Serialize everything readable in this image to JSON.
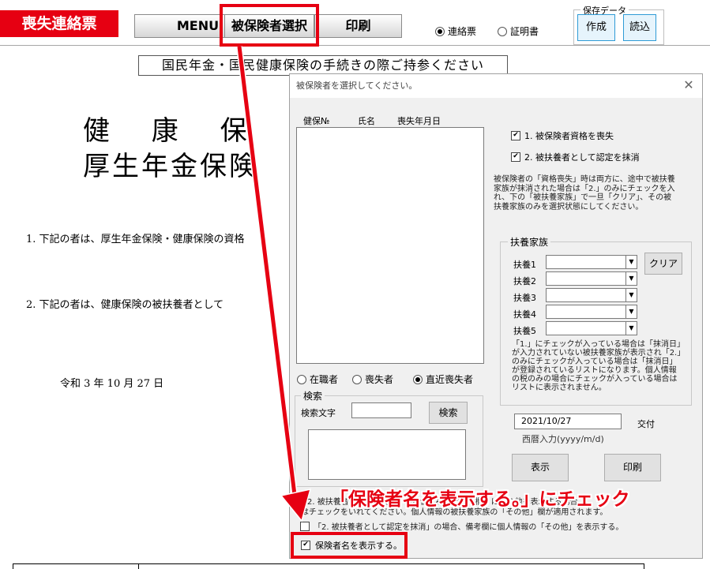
{
  "toolbar": {
    "title": "喪失連絡票",
    "menu": "MENU",
    "select_insured": "被保険者選択",
    "print": "印刷",
    "radio_contact": "連絡票",
    "radio_certificate": "証明書",
    "save_data_legend": "保存データ",
    "create": "作成",
    "load": "読込"
  },
  "document": {
    "notice": "国民年金・国民健康保険の手続きの際ご持参ください",
    "title_line1": "健 康 保 険",
    "title_line2": "厚生年金保険",
    "item1": "1. 下記の者は、厚生年金保険・健康保険の資格",
    "item2": "2. 下記の者は、健康保険の被扶養者として",
    "date": "令和 3 年 10 月 27 日"
  },
  "dialog": {
    "title": "被保険者を選択してください。",
    "columns": [
      "健保№",
      "氏名",
      "喪失年月日"
    ],
    "check1": "1. 被保険者資格を喪失",
    "check2": "2. 被扶養者として認定を抹消",
    "explanation": "被保険者の「資格喪失」時は両方に、途中で被扶養家族が抹消された場合は「2.」のみにチェックを入れ、下の「被扶養家族」で一旦「クリア」、その被扶養家族のみを選択状態にしてください。",
    "dependents_legend": "扶養家族",
    "dependents": [
      "扶養1",
      "扶養2",
      "扶養3",
      "扶養4",
      "扶養5"
    ],
    "clear": "クリア",
    "dependents_note": "「1.」にチェックが入っている場合は「抹消日」が入力されていない被扶養家族が表示され「2.」のみにチェックが入っている場合は「抹消日」が登録されているリストになります。個人情報の税のみの場合にチェックが入っている場合はリストに表示されません。",
    "status_employed": "在職者",
    "status_lost": "喪失者",
    "status_recent": "直近喪失者",
    "search_legend": "検索",
    "search_label": "検索文字",
    "search_value": "",
    "search_button": "検索",
    "date_value": "2021/10/27",
    "issue_label": "交付",
    "date_hint": "西暦入力(yyyy/m/d)",
    "show_button": "表示",
    "print_button": "印刷",
    "note_line1": "2. 被扶養者の「資格喪失」の場合「被保険者考欄」にその他を表示する場合",
    "note_line2": "はチェックをいれてください。個人情報の被扶養家族の「その他」欄が適用されます。",
    "note_line3": "「2. 被扶養者として認定を抹消」の場合、備考欄に個人情報の「その他」を表示する。",
    "show_name_check": "保険者名を表示する。"
  },
  "annotation": "「保険者名を表示する。」にチェック",
  "colors": {
    "accent_red": "#e60012",
    "button_blue_border": "#2f9bd6"
  }
}
